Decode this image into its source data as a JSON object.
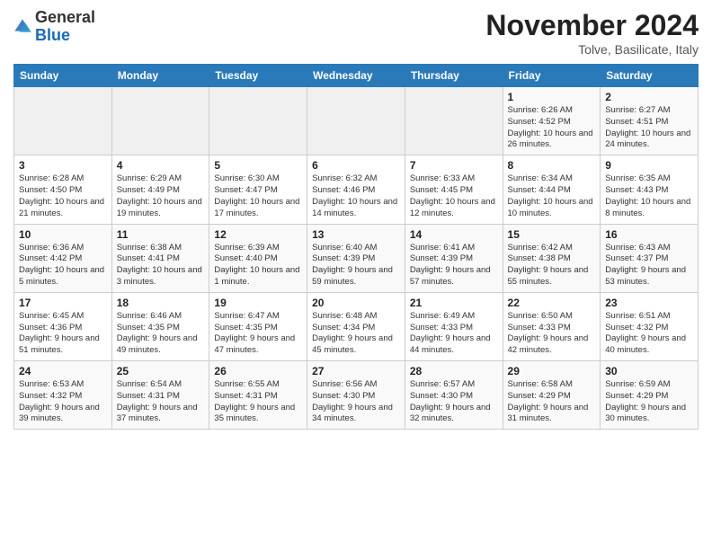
{
  "header": {
    "logo_general": "General",
    "logo_blue": "Blue",
    "month_title": "November 2024",
    "location": "Tolve, Basilicate, Italy"
  },
  "days_of_week": [
    "Sunday",
    "Monday",
    "Tuesday",
    "Wednesday",
    "Thursday",
    "Friday",
    "Saturday"
  ],
  "weeks": [
    [
      {
        "day": "",
        "info": ""
      },
      {
        "day": "",
        "info": ""
      },
      {
        "day": "",
        "info": ""
      },
      {
        "day": "",
        "info": ""
      },
      {
        "day": "",
        "info": ""
      },
      {
        "day": "1",
        "info": "Sunrise: 6:26 AM\nSunset: 4:52 PM\nDaylight: 10 hours and 26 minutes."
      },
      {
        "day": "2",
        "info": "Sunrise: 6:27 AM\nSunset: 4:51 PM\nDaylight: 10 hours and 24 minutes."
      }
    ],
    [
      {
        "day": "3",
        "info": "Sunrise: 6:28 AM\nSunset: 4:50 PM\nDaylight: 10 hours and 21 minutes."
      },
      {
        "day": "4",
        "info": "Sunrise: 6:29 AM\nSunset: 4:49 PM\nDaylight: 10 hours and 19 minutes."
      },
      {
        "day": "5",
        "info": "Sunrise: 6:30 AM\nSunset: 4:47 PM\nDaylight: 10 hours and 17 minutes."
      },
      {
        "day": "6",
        "info": "Sunrise: 6:32 AM\nSunset: 4:46 PM\nDaylight: 10 hours and 14 minutes."
      },
      {
        "day": "7",
        "info": "Sunrise: 6:33 AM\nSunset: 4:45 PM\nDaylight: 10 hours and 12 minutes."
      },
      {
        "day": "8",
        "info": "Sunrise: 6:34 AM\nSunset: 4:44 PM\nDaylight: 10 hours and 10 minutes."
      },
      {
        "day": "9",
        "info": "Sunrise: 6:35 AM\nSunset: 4:43 PM\nDaylight: 10 hours and 8 minutes."
      }
    ],
    [
      {
        "day": "10",
        "info": "Sunrise: 6:36 AM\nSunset: 4:42 PM\nDaylight: 10 hours and 5 minutes."
      },
      {
        "day": "11",
        "info": "Sunrise: 6:38 AM\nSunset: 4:41 PM\nDaylight: 10 hours and 3 minutes."
      },
      {
        "day": "12",
        "info": "Sunrise: 6:39 AM\nSunset: 4:40 PM\nDaylight: 10 hours and 1 minute."
      },
      {
        "day": "13",
        "info": "Sunrise: 6:40 AM\nSunset: 4:39 PM\nDaylight: 9 hours and 59 minutes."
      },
      {
        "day": "14",
        "info": "Sunrise: 6:41 AM\nSunset: 4:39 PM\nDaylight: 9 hours and 57 minutes."
      },
      {
        "day": "15",
        "info": "Sunrise: 6:42 AM\nSunset: 4:38 PM\nDaylight: 9 hours and 55 minutes."
      },
      {
        "day": "16",
        "info": "Sunrise: 6:43 AM\nSunset: 4:37 PM\nDaylight: 9 hours and 53 minutes."
      }
    ],
    [
      {
        "day": "17",
        "info": "Sunrise: 6:45 AM\nSunset: 4:36 PM\nDaylight: 9 hours and 51 minutes."
      },
      {
        "day": "18",
        "info": "Sunrise: 6:46 AM\nSunset: 4:35 PM\nDaylight: 9 hours and 49 minutes."
      },
      {
        "day": "19",
        "info": "Sunrise: 6:47 AM\nSunset: 4:35 PM\nDaylight: 9 hours and 47 minutes."
      },
      {
        "day": "20",
        "info": "Sunrise: 6:48 AM\nSunset: 4:34 PM\nDaylight: 9 hours and 45 minutes."
      },
      {
        "day": "21",
        "info": "Sunrise: 6:49 AM\nSunset: 4:33 PM\nDaylight: 9 hours and 44 minutes."
      },
      {
        "day": "22",
        "info": "Sunrise: 6:50 AM\nSunset: 4:33 PM\nDaylight: 9 hours and 42 minutes."
      },
      {
        "day": "23",
        "info": "Sunrise: 6:51 AM\nSunset: 4:32 PM\nDaylight: 9 hours and 40 minutes."
      }
    ],
    [
      {
        "day": "24",
        "info": "Sunrise: 6:53 AM\nSunset: 4:32 PM\nDaylight: 9 hours and 39 minutes."
      },
      {
        "day": "25",
        "info": "Sunrise: 6:54 AM\nSunset: 4:31 PM\nDaylight: 9 hours and 37 minutes."
      },
      {
        "day": "26",
        "info": "Sunrise: 6:55 AM\nSunset: 4:31 PM\nDaylight: 9 hours and 35 minutes."
      },
      {
        "day": "27",
        "info": "Sunrise: 6:56 AM\nSunset: 4:30 PM\nDaylight: 9 hours and 34 minutes."
      },
      {
        "day": "28",
        "info": "Sunrise: 6:57 AM\nSunset: 4:30 PM\nDaylight: 9 hours and 32 minutes."
      },
      {
        "day": "29",
        "info": "Sunrise: 6:58 AM\nSunset: 4:29 PM\nDaylight: 9 hours and 31 minutes."
      },
      {
        "day": "30",
        "info": "Sunrise: 6:59 AM\nSunset: 4:29 PM\nDaylight: 9 hours and 30 minutes."
      }
    ]
  ]
}
